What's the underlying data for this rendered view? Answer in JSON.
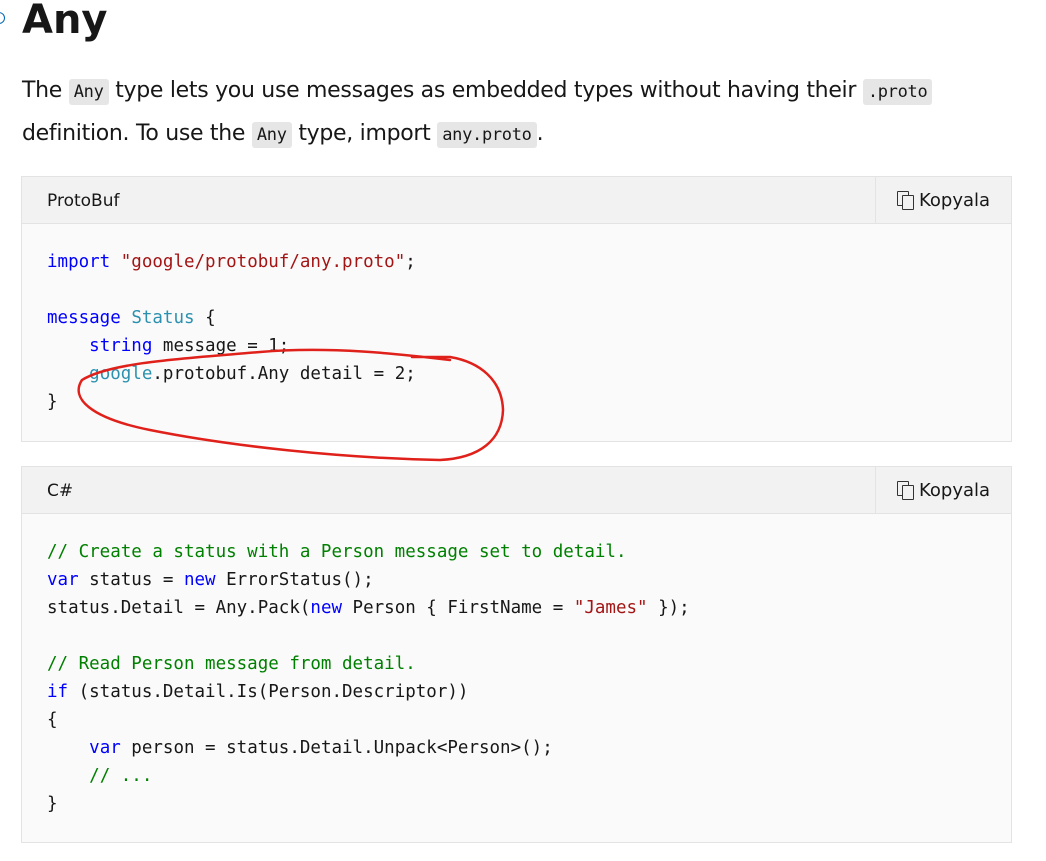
{
  "heading": "Any",
  "intro": {
    "t1": "The ",
    "c1": "Any",
    "t2": " type lets you use messages as embedded types without having their ",
    "c2": ".proto",
    "t3": " definition. To use the ",
    "c3": "Any",
    "t4": " type, import ",
    "c4": "any.proto",
    "t5": "."
  },
  "blocks": [
    {
      "language": "ProtoBuf",
      "copy_label": "Kopyala",
      "lines": [
        [
          {
            "t": "import",
            "c": "kw"
          },
          {
            "t": " "
          },
          {
            "t": "\"google/protobuf/any.proto\"",
            "c": "str"
          },
          {
            "t": ";"
          }
        ],
        [],
        [
          {
            "t": "message",
            "c": "kw"
          },
          {
            "t": " "
          },
          {
            "t": "Status",
            "c": "type"
          },
          {
            "t": " {"
          }
        ],
        [
          {
            "t": "    "
          },
          {
            "t": "string",
            "c": "kw"
          },
          {
            "t": " message = 1;"
          }
        ],
        [
          {
            "t": "    "
          },
          {
            "t": "google",
            "c": "type"
          },
          {
            "t": ".protobuf.Any detail = 2;"
          }
        ],
        [
          {
            "t": "}"
          }
        ]
      ]
    },
    {
      "language": "C#",
      "copy_label": "Kopyala",
      "lines": [
        [
          {
            "t": "// Create a status with a Person message set to detail.",
            "c": "cm"
          }
        ],
        [
          {
            "t": "var",
            "c": "kw"
          },
          {
            "t": " status = "
          },
          {
            "t": "new",
            "c": "kw"
          },
          {
            "t": " ErrorStatus();"
          }
        ],
        [
          {
            "t": "status.Detail = Any.Pack("
          },
          {
            "t": "new",
            "c": "kw"
          },
          {
            "t": " Person { FirstName = "
          },
          {
            "t": "\"James\"",
            "c": "str"
          },
          {
            "t": " });"
          }
        ],
        [],
        [
          {
            "t": "// Read Person message from detail.",
            "c": "cm"
          }
        ],
        [
          {
            "t": "if",
            "c": "kw"
          },
          {
            "t": " (status.Detail.Is(Person.Descriptor))"
          }
        ],
        [
          {
            "t": "{"
          }
        ],
        [
          {
            "t": "    "
          },
          {
            "t": "var",
            "c": "kw"
          },
          {
            "t": " person = status.Detail.Unpack<Person>();"
          }
        ],
        [
          {
            "t": "    "
          },
          {
            "t": "// ...",
            "c": "cm"
          }
        ],
        [
          {
            "t": "}"
          }
        ]
      ]
    }
  ],
  "colors": {
    "keyword": "#0000ff",
    "string": "#a31515",
    "type": "#2b91af",
    "comment": "#008000",
    "annotation": "#e0201a"
  }
}
